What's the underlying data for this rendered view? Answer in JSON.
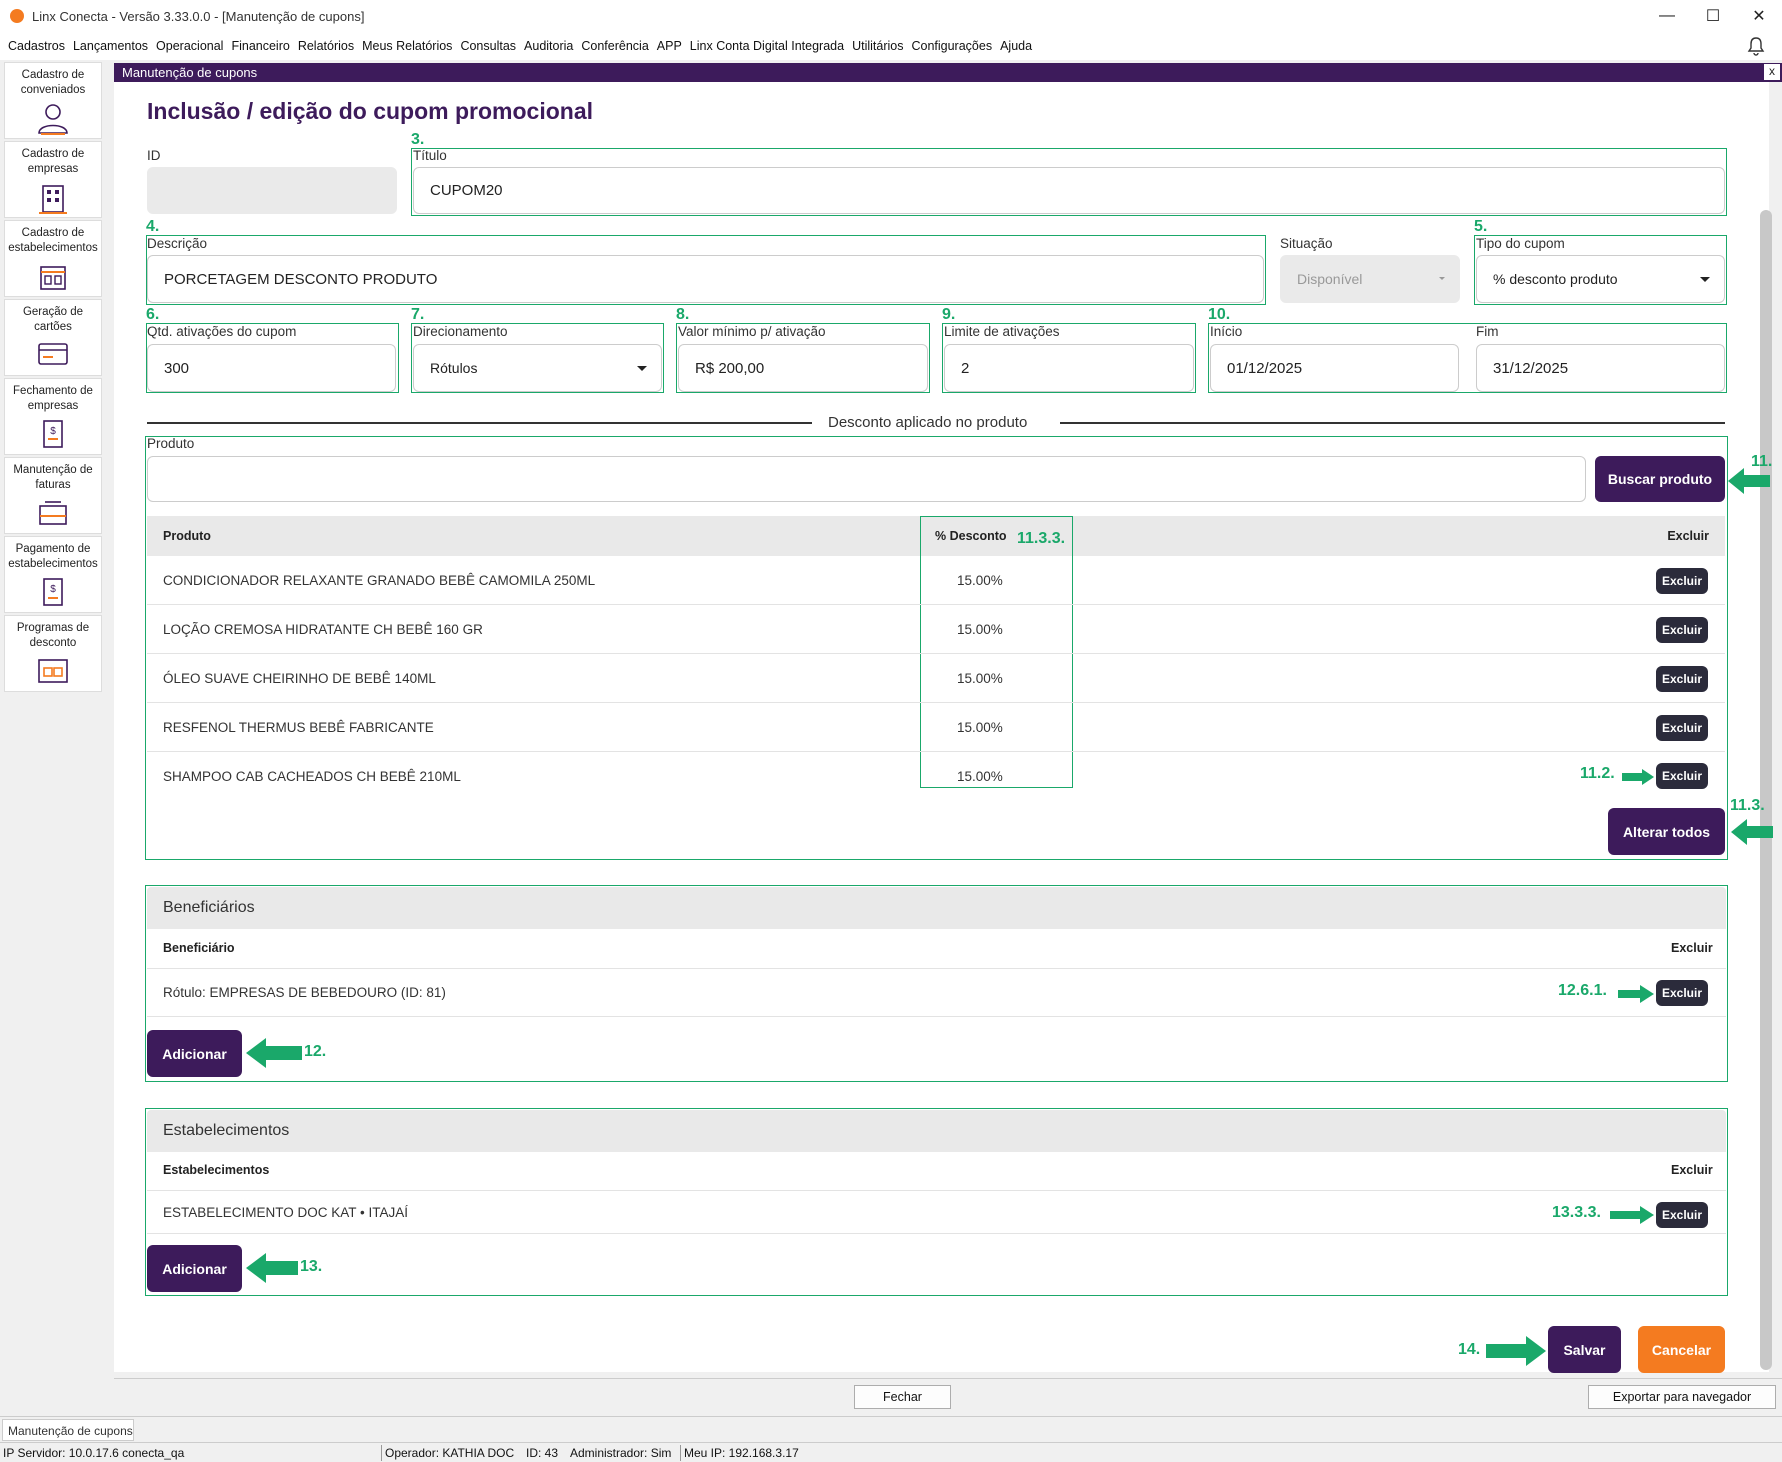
{
  "window": {
    "title": "Linx Conecta - Versão 3.33.0.0 - [Manutenção de cupons]"
  },
  "menu": [
    "Cadastros",
    "Lançamentos",
    "Operacional",
    "Financeiro",
    "Relatórios",
    "Meus Relatórios",
    "Consultas",
    "Auditoria",
    "Conferência",
    "APP",
    "Linx Conta Digital Integrada",
    "Utilitários",
    "Configurações",
    "Ajuda"
  ],
  "sidebar": [
    {
      "label": "Cadastro de conveniados",
      "icon": "user-icon"
    },
    {
      "label": "Cadastro de empresas",
      "icon": "building-icon"
    },
    {
      "label": "Cadastro de estabelecimentos",
      "icon": "store-icon"
    },
    {
      "label": "Geração de cartões",
      "icon": "card-icon"
    },
    {
      "label": "Fechamento de empresas",
      "icon": "invoice-dollar-icon"
    },
    {
      "label": "Manutenção de faturas",
      "icon": "inbox-icon"
    },
    {
      "label": "Pagamento de estabelecimentos",
      "icon": "payment-icon"
    },
    {
      "label": "Programas de desconto",
      "icon": "discount-program-icon"
    }
  ],
  "panel": {
    "title": "Manutenção de cupons",
    "close": "x"
  },
  "form": {
    "heading": "Inclusão / edição do cupom promocional",
    "id_label": "ID",
    "id_value": "",
    "titulo_label": "Título",
    "titulo_value": "CUPOM20",
    "descricao_label": "Descrição",
    "descricao_value": "PORCETAGEM DESCONTO PRODUTO",
    "situacao_label": "Situação",
    "situacao_value": "Disponível",
    "tipo_label": "Tipo do cupom",
    "tipo_value": "% desconto produto",
    "qtd_label": "Qtd. ativações do cupom",
    "qtd_value": "300",
    "direc_label": "Direcionamento",
    "direc_value": "Rótulos",
    "valor_label": "Valor mínimo p/ ativação",
    "valor_value": "R$ 200,00",
    "limite_label": "Limite de ativações",
    "limite_value": "2",
    "inicio_label": "Início",
    "inicio_value": "01/12/2025",
    "fim_label": "Fim",
    "fim_value": "31/12/2025"
  },
  "discount": {
    "section_title": "Desconto aplicado no produto",
    "produto_label": "Produto",
    "produto_value": "",
    "buscar_button": "Buscar produto",
    "columns": {
      "produto": "Produto",
      "desconto": "% Desconto",
      "excluir": "Excluir"
    },
    "rows": [
      {
        "produto": "CONDICIONADOR RELAXANTE GRANADO BEBÊ CAMOMILA 250ML",
        "desconto": "15.00%",
        "action": "Excluir"
      },
      {
        "produto": "LOÇÃO CREMOSA HIDRATANTE CH BEBÊ 160 GR",
        "desconto": "15.00%",
        "action": "Excluir"
      },
      {
        "produto": "ÓLEO SUAVE CHEIRINHO DE BEBÊ 140ML",
        "desconto": "15.00%",
        "action": "Excluir"
      },
      {
        "produto": "RESFENOL THERMUS BEBÊ FABRICANTE",
        "desconto": "15.00%",
        "action": "Excluir"
      },
      {
        "produto": "SHAMPOO CAB CACHEADOS CH BEBÊ 210ML",
        "desconto": "15.00%",
        "action": "Excluir"
      }
    ],
    "alterar_button": "Alterar todos"
  },
  "beneficiarios": {
    "title": "Beneficiários",
    "col": "Beneficiário",
    "col_excluir": "Excluir",
    "rows": [
      {
        "label": "Rótulo: EMPRESAS DE BEBEDOURO (ID: 81)",
        "action": "Excluir"
      }
    ],
    "add_button": "Adicionar"
  },
  "estabelecimentos": {
    "title": "Estabelecimentos",
    "col": "Estabelecimentos",
    "col_excluir": "Excluir",
    "rows": [
      {
        "label": "ESTABELECIMENTO DOC KAT • ITAJAÍ",
        "action": "Excluir"
      }
    ],
    "add_button": "Adicionar"
  },
  "actions": {
    "salvar": "Salvar",
    "cancelar": "Cancelar"
  },
  "annotations": {
    "n3": "3.",
    "n4": "4.",
    "n5": "5.",
    "n6": "6.",
    "n7": "7.",
    "n8": "8.",
    "n9": "9.",
    "n10": "10.",
    "n11": "11.",
    "n11_2": "11.2.",
    "n11_3": "11.3.",
    "n11_3_3": "11.3.3.",
    "n12": "12.",
    "n12_6_1": "12.6.1.",
    "n13": "13.",
    "n13_3_3": "13.3.3.",
    "n14": "14."
  },
  "bottom": {
    "fechar": "Fechar",
    "exportar": "Exportar para navegador",
    "tab": "Manutenção de cupons"
  },
  "status": {
    "ip_servidor": "IP Servidor: 10.0.17.6 conecta_qa",
    "operador": "Operador: KATHIA DOC",
    "id": "ID: 43",
    "admin": "Administrador: Sim",
    "meu_ip": "Meu IP: 192.168.3.17"
  },
  "colors": {
    "brand": "#3d1b5b",
    "annotation": "#1aa86a",
    "cancel": "#f47b20",
    "excluir": "#2b2b3b"
  }
}
